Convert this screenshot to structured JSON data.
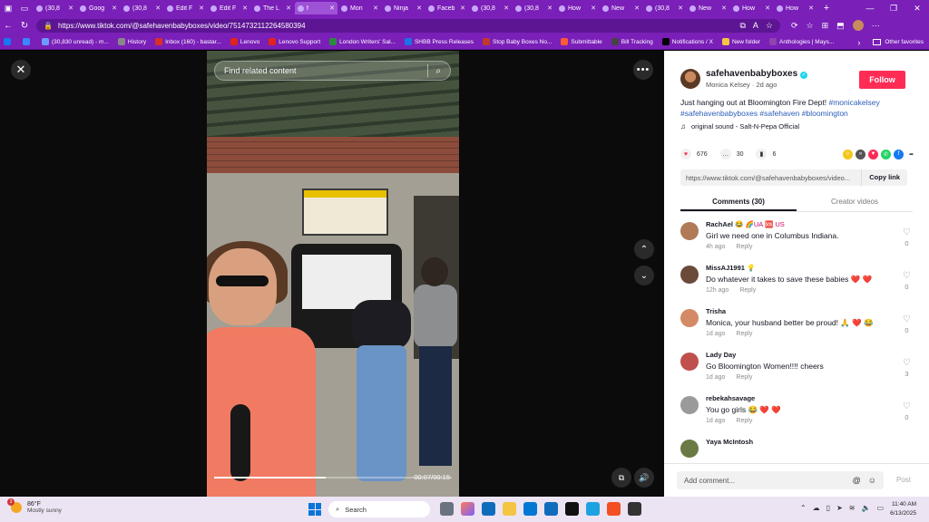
{
  "browser": {
    "tabs": [
      {
        "label": "(30,8",
        "active": false
      },
      {
        "label": "Goog",
        "active": false
      },
      {
        "label": "(30,8",
        "active": false
      },
      {
        "label": "Edit F",
        "active": false
      },
      {
        "label": "Edit F",
        "active": false
      },
      {
        "label": "The L",
        "active": false
      },
      {
        "label": "f",
        "active": true
      },
      {
        "label": "Mon",
        "active": false
      },
      {
        "label": "Ninja",
        "active": false
      },
      {
        "label": "Faceb",
        "active": false
      },
      {
        "label": "(30,8",
        "active": false
      },
      {
        "label": "(30,8",
        "active": false
      },
      {
        "label": "How",
        "active": false
      },
      {
        "label": "New",
        "active": false
      },
      {
        "label": "(30,8",
        "active": false
      },
      {
        "label": "New",
        "active": false
      },
      {
        "label": "How",
        "active": false
      },
      {
        "label": "How",
        "active": false
      }
    ],
    "url": "https://www.tiktok.com/@safehavenbabyboxes/video/7514732112264580394",
    "bookmarks": [
      {
        "label": "",
        "color": "#1877f2"
      },
      {
        "label": "",
        "color": "#3a86ff"
      },
      {
        "label": "(30,830 unread) - m...",
        "color": "#6b9bff"
      },
      {
        "label": "History",
        "color": "#888"
      },
      {
        "label": "Inbox (160) - bastar...",
        "color": "#d93025"
      },
      {
        "label": "Lenovo",
        "color": "#e2231a"
      },
      {
        "label": "Lenovo Support",
        "color": "#e2231a"
      },
      {
        "label": "London Writers' Sal...",
        "color": "#2b8a3e"
      },
      {
        "label": "SHBB Press Releases",
        "color": "#1a73e8"
      },
      {
        "label": "Stop Baby Boxes No...",
        "color": "#c0392b"
      },
      {
        "label": "Submittable",
        "color": "#ff5a36"
      },
      {
        "label": "Bill Tracking",
        "color": "#444"
      },
      {
        "label": "Notifications / X",
        "color": "#000"
      },
      {
        "label": "New folder",
        "color": "#f4c542"
      },
      {
        "label": "Anthologies | Mays...",
        "color": "#8e44ad"
      }
    ],
    "other_favorites": "Other favorites"
  },
  "video": {
    "search_placeholder": "Find related content",
    "time": "00:07/00:15",
    "progress": 0.47
  },
  "post": {
    "username": "safehavenbabyboxes",
    "display_name": "Monica Kelsey",
    "age": "2d ago",
    "follow_label": "Follow",
    "caption_text": "Just hanging out at Bloomington Fire Dept! ",
    "hashtags": "#monicakelsey #safehavenbabyboxes #safehaven #bloomington",
    "sound": "original sound - Salt-N-Pepa Official",
    "likes": "676",
    "comments": "30",
    "saves": "6",
    "link": "https://www.tiktok.com/@safehavenbabyboxes/video...",
    "copy_label": "Copy link",
    "tab_comments": "Comments (30)",
    "tab_creator": "Creator videos",
    "comment_placeholder": "Add comment...",
    "post_label": "Post"
  },
  "comments": [
    {
      "user": "RachAel",
      "emoji": "😂 🌈UA 🆘 US",
      "text": "Girl we need one in Columbus Indiana.",
      "time": "4h ago",
      "reply": "Reply",
      "likes": "0",
      "avatar": "#b07a58"
    },
    {
      "user": "MissAJ1991",
      "emoji": "💡",
      "text": "Do whatever it takes to save these babies ❤️ ❤️",
      "time": "12h ago",
      "reply": "Reply",
      "likes": "0",
      "avatar": "#6b4a3a"
    },
    {
      "user": "Trisha",
      "emoji": "",
      "text": "Monica, your husband better be proud! 🙏 ❤️ 😂",
      "time": "1d ago",
      "reply": "Reply",
      "likes": "0",
      "avatar": "#d48a66"
    },
    {
      "user": "Lady Day",
      "emoji": "",
      "text": "Go Bloomington Women!!!! cheers",
      "time": "1d ago",
      "reply": "Reply",
      "likes": "3",
      "avatar": "#c0504d"
    },
    {
      "user": "rebekahsavage",
      "emoji": "",
      "text": "You go girls 😂 ❤️ ❤️",
      "time": "1d ago",
      "reply": "Reply",
      "likes": "0",
      "avatar": "#9a9a9a"
    },
    {
      "user": "Yaya McIntosh",
      "emoji": "",
      "text": "",
      "time": "",
      "reply": "",
      "likes": "",
      "avatar": "#6b7a44"
    }
  ],
  "taskbar": {
    "temp": "86°F",
    "condition": "Mostly sunny",
    "badge": "3",
    "search_label": "Search",
    "time": "11:40 AM",
    "date": "6/13/2025"
  }
}
